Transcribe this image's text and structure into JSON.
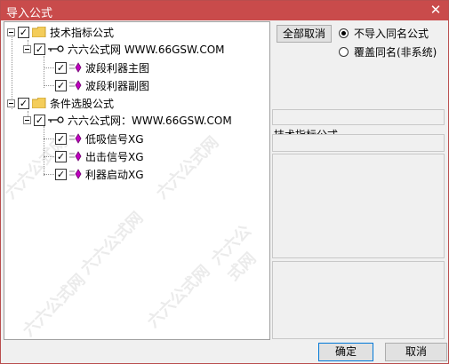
{
  "window": {
    "title": "导入公式",
    "close_glyph": "✕"
  },
  "tree": {
    "groups": [
      {
        "label": "技术指标公式",
        "checked": true,
        "source": "六六公式网 WWW.66GSW.COM",
        "items": [
          "波段利器主图",
          "波段利器副图"
        ]
      },
      {
        "label": "条件选股公式",
        "checked": true,
        "source": "六六公式网：WWW.66GSW.COM",
        "items": [
          "低吸信号XG",
          "出击信号XG",
          "利器启动XG"
        ]
      }
    ],
    "check_glyph": "✓"
  },
  "options": {
    "deselect_all": "全部取消",
    "radio_skip": "不导入同名公式",
    "radio_overwrite": "覆盖同名(非系统)",
    "selected": "radio_skip"
  },
  "info": {
    "section_label": "技术指标公式"
  },
  "footer": {
    "ok": "确定",
    "cancel": "取消"
  },
  "watermark_text": "六六公式网"
}
